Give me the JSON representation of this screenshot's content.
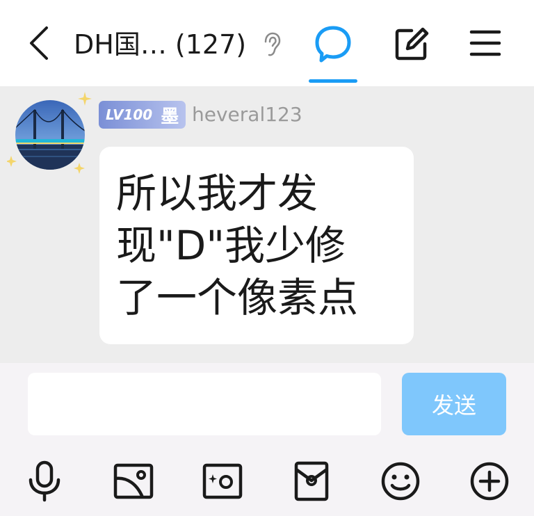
{
  "header": {
    "title": "DH国… (127)",
    "back_icon": "chevron-left-icon",
    "ear_icon": "ear-icon",
    "chat_icon": "chat-bubble-icon",
    "edit_icon": "edit-square-icon",
    "menu_icon": "hamburger-menu-icon"
  },
  "message": {
    "sender_level": "LV100",
    "sender_badge_char": "墨",
    "sender_name": "heveral123",
    "text": "所以我才发\n现\"D\"我少修\n了一个像素点"
  },
  "composer": {
    "input_value": "",
    "send_label": "发送"
  },
  "toolbar": {
    "items": [
      "microphone-icon",
      "image-icon",
      "camera-icon",
      "red-packet-icon",
      "emoji-icon",
      "plus-circle-icon"
    ]
  },
  "colors": {
    "accent": "#1a9cf5",
    "send_button": "#7fc7fc",
    "badge_start": "#7a8fd6",
    "badge_end": "#b8c3ee",
    "chat_background": "#ededed",
    "composer_background": "#f5f3f6"
  }
}
